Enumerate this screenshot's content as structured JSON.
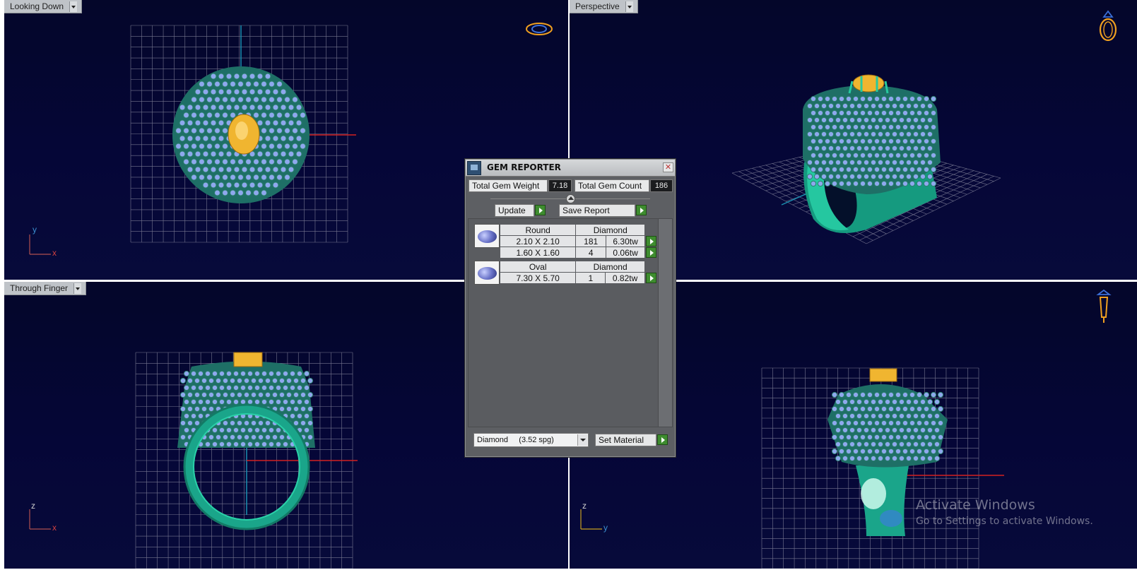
{
  "viewports": {
    "top_left": {
      "label": "Looking Down",
      "axis_1": "y",
      "axis_2": "x",
      "nav_icon": "ring-top-view-icon"
    },
    "top_right": {
      "label": "Perspective",
      "nav_icon": "ring-perspective-icon"
    },
    "bottom_left": {
      "label": "Through Finger",
      "axis_1": "z",
      "axis_2": "x"
    },
    "bottom_right": {
      "axis_1": "z",
      "axis_2": "y",
      "nav_icon": "ring-side-view-icon"
    }
  },
  "gem_reporter": {
    "title": "GEM REPORTER",
    "total_weight_label": "Total Gem Weight",
    "total_weight_value": "7.18",
    "total_count_label": "Total Gem Count",
    "total_count_value": "186",
    "update_label": "Update",
    "save_report_label": "Save Report",
    "groups": [
      {
        "shape": "Round",
        "material": "Diamond",
        "rows": [
          {
            "size": "2.10 X 2.10",
            "count": "181",
            "weight": "6.30tw"
          },
          {
            "size": "1.60 X 1.60",
            "count": "4",
            "weight": "0.06tw"
          }
        ]
      },
      {
        "shape": "Oval",
        "material": "Diamond",
        "rows": [
          {
            "size": "7.30 X 5.70",
            "count": "1",
            "weight": "0.82tw"
          }
        ]
      }
    ],
    "material_select": "Diamond     (3.52 spg)",
    "set_material_label": "Set Material"
  },
  "watermark": {
    "line1": "Activate Windows",
    "line2": "Go to Settings to activate Windows."
  },
  "colors": {
    "viewport_bg": "#05063a",
    "grid": "#8a8aa0",
    "metal": "#23b896",
    "gem": "#8ea8ee",
    "center_stone": "#f0b530",
    "axis_x": "#d42020",
    "axis_y": "#1a8fb0"
  }
}
